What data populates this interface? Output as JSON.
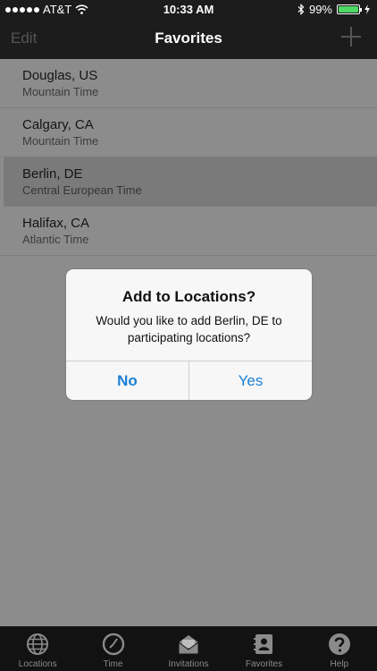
{
  "status_bar": {
    "carrier": "AT&T",
    "time": "10:33 AM",
    "battery_percent": "99%",
    "battery_level": 0.99
  },
  "nav": {
    "edit_label": "Edit",
    "title": "Favorites"
  },
  "favorites": [
    {
      "city": "Douglas, US",
      "zone": "Mountain Time",
      "selected": false
    },
    {
      "city": "Calgary, CA",
      "zone": "Mountain Time",
      "selected": false
    },
    {
      "city": "Berlin, DE",
      "zone": "Central European Time",
      "selected": true
    },
    {
      "city": "Halifax, CA",
      "zone": "Atlantic Time",
      "selected": false
    }
  ],
  "alert": {
    "title": "Add to Locations?",
    "message": "Would you like to add Berlin, DE to participating locations?",
    "no_label": "No",
    "yes_label": "Yes"
  },
  "tabs": [
    {
      "label": "Locations",
      "icon": "globe-icon"
    },
    {
      "label": "Time",
      "icon": "clock-icon"
    },
    {
      "label": "Invitations",
      "icon": "envelope-icon"
    },
    {
      "label": "Favorites",
      "icon": "contact-book-icon"
    },
    {
      "label": "Help",
      "icon": "question-icon"
    }
  ],
  "colors": {
    "accent": "#1a7fd4",
    "battery": "#4cd964"
  }
}
